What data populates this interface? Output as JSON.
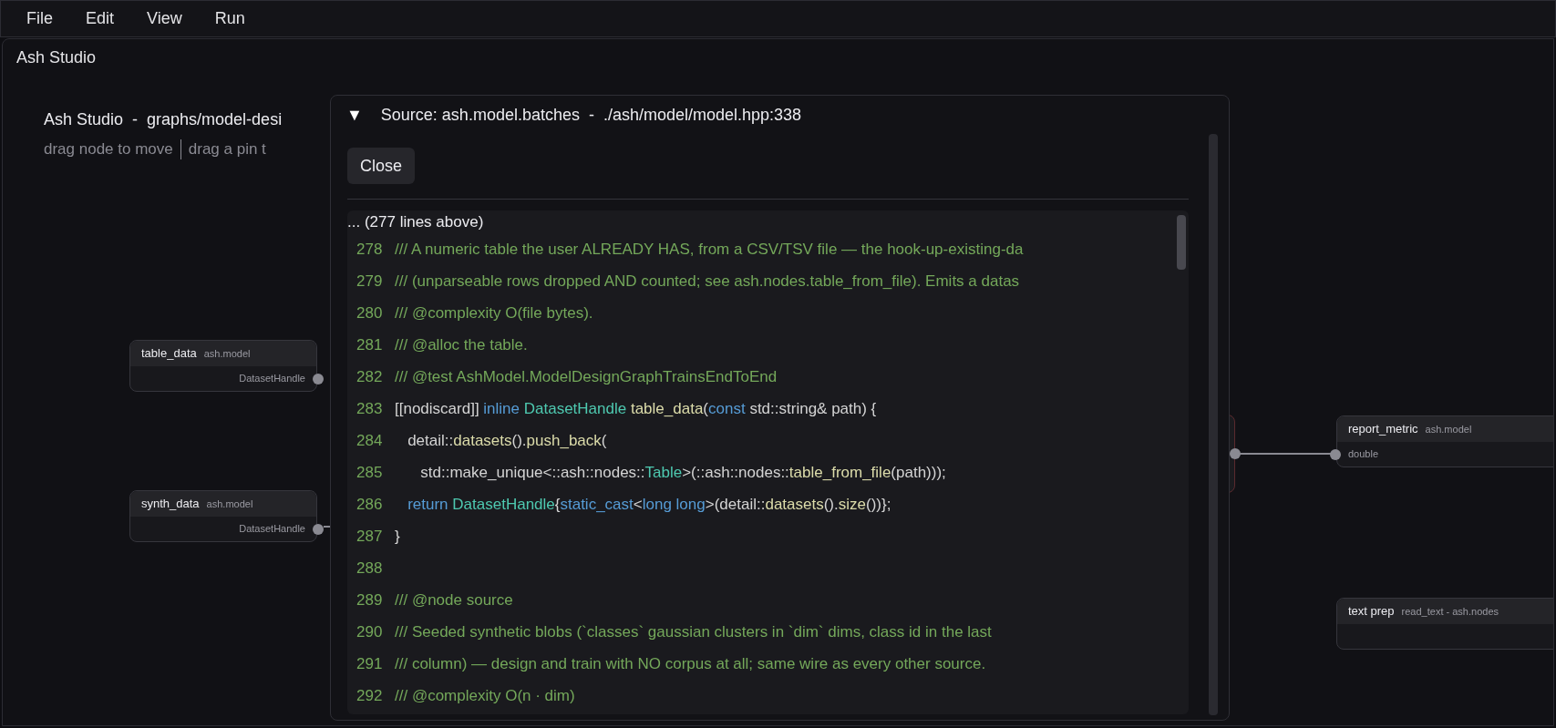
{
  "menu": [
    "File",
    "Edit",
    "View",
    "Run"
  ],
  "panel": {
    "title": "Ash Studio"
  },
  "canvas": {
    "heading": "Ash Studio  -  graphs/model-desi",
    "hints": [
      "drag node to move",
      "drag a pin t"
    ],
    "nodes": [
      {
        "name": "table_data",
        "module": "ash.model",
        "ports": [
          {
            "kind": "output",
            "label": "DatasetHandle"
          }
        ]
      },
      {
        "name": "synth_data",
        "module": "ash.model",
        "ports": [
          {
            "kind": "output",
            "label": "DatasetHandle"
          }
        ]
      },
      {
        "name": "report_metric",
        "module": "ash.model",
        "ports": [
          {
            "kind": "input",
            "label": "double"
          }
        ]
      },
      {
        "name": "text prep",
        "module": "read_text - ash.nodes"
      }
    ]
  },
  "source_popup": {
    "toggle": "▼",
    "title": "Source: ash.model.batches  -  ./ash/model/model.hpp:338",
    "close": "Close",
    "above": "... (277 lines above)",
    "lines": [
      {
        "number": "278",
        "tokens": [
          {
            "kind": "comment",
            "text": "/// A numeric table the user ALREADY HAS, from a CSV/TSV file — the hook-up-existing-da"
          }
        ]
      },
      {
        "number": "279",
        "tokens": [
          {
            "kind": "comment",
            "text": "/// (unparseable rows dropped AND counted; see ash.nodes.table_from_file). Emits a datas"
          }
        ]
      },
      {
        "number": "280",
        "tokens": [
          {
            "kind": "comment",
            "text": "/// @complexity O(file bytes)."
          }
        ]
      },
      {
        "number": "281",
        "tokens": [
          {
            "kind": "comment",
            "text": "/// @alloc the table."
          }
        ]
      },
      {
        "number": "282",
        "tokens": [
          {
            "kind": "comment",
            "text": "/// @test AshModel.ModelDesignGraphTrainsEndToEnd"
          }
        ]
      },
      {
        "number": "283",
        "tokens": [
          {
            "kind": "plain",
            "text": "[[nodiscard]] "
          },
          {
            "kind": "keyword",
            "text": "inline"
          },
          {
            "kind": "type",
            "text": " DatasetHandle"
          },
          {
            "kind": "function",
            "text": " table_data"
          },
          {
            "kind": "plain",
            "text": "("
          },
          {
            "kind": "keyword",
            "text": "const"
          },
          {
            "kind": "plain",
            "text": " std::string& path) {"
          }
        ]
      },
      {
        "number": "284",
        "tokens": [
          {
            "kind": "plain",
            "text": "   detail::"
          },
          {
            "kind": "function",
            "text": "datasets"
          },
          {
            "kind": "plain",
            "text": "()."
          },
          {
            "kind": "function",
            "text": "push_back"
          },
          {
            "kind": "plain",
            "text": "("
          }
        ]
      },
      {
        "number": "285",
        "tokens": [
          {
            "kind": "plain",
            "text": "      std::make_unique<::ash::nodes::"
          },
          {
            "kind": "type",
            "text": "Table"
          },
          {
            "kind": "plain",
            "text": ">(::ash::nodes::"
          },
          {
            "kind": "function",
            "text": "table_from_file"
          },
          {
            "kind": "plain",
            "text": "(path)));"
          }
        ]
      },
      {
        "number": "286",
        "tokens": [
          {
            "kind": "keyword",
            "text": "   return"
          },
          {
            "kind": "type",
            "text": " DatasetHandle"
          },
          {
            "kind": "plain",
            "text": "{"
          },
          {
            "kind": "keyword",
            "text": "static_cast"
          },
          {
            "kind": "plain",
            "text": "<"
          },
          {
            "kind": "keyword",
            "text": "long long"
          },
          {
            "kind": "plain",
            "text": ">(detail::"
          },
          {
            "kind": "function",
            "text": "datasets"
          },
          {
            "kind": "plain",
            "text": "()."
          },
          {
            "kind": "function",
            "text": "size"
          },
          {
            "kind": "plain",
            "text": "())};"
          }
        ]
      },
      {
        "number": "287",
        "tokens": [
          {
            "kind": "plain",
            "text": "}"
          }
        ]
      },
      {
        "number": "288"
      },
      {
        "number": "289",
        "tokens": [
          {
            "kind": "comment",
            "text": "/// @node source"
          }
        ]
      },
      {
        "number": "290",
        "tokens": [
          {
            "kind": "comment",
            "text": "/// Seeded synthetic blobs (`classes` gaussian clusters in `dim` dims, class id in the last"
          }
        ]
      },
      {
        "number": "291",
        "tokens": [
          {
            "kind": "comment",
            "text": "/// column) — design and train with NO corpus at all; same wire as every other source."
          }
        ]
      },
      {
        "number": "292",
        "tokens": [
          {
            "kind": "comment",
            "text": "/// @complexity O(n · dim)"
          }
        ]
      }
    ]
  }
}
